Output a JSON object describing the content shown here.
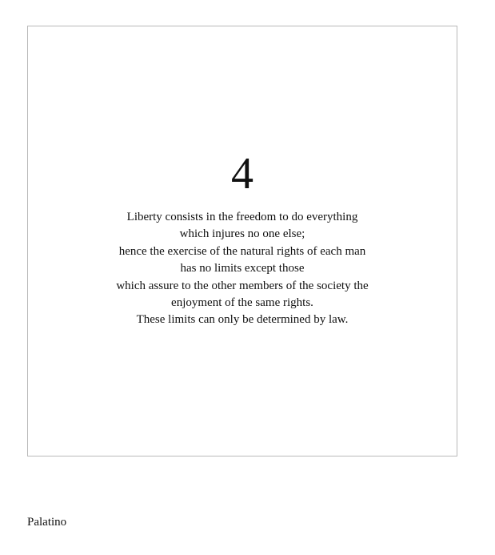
{
  "card": {
    "number": "4",
    "lines": [
      "Liberty consists in the freedom to do everything",
      "which injures no one else;",
      "hence the exercise of the natural rights of each man",
      "has no limits except those",
      "which assure to the other members of the society the",
      "enjoyment of the same rights.",
      "These limits can only be determined by law."
    ]
  },
  "caption": "Palatino"
}
